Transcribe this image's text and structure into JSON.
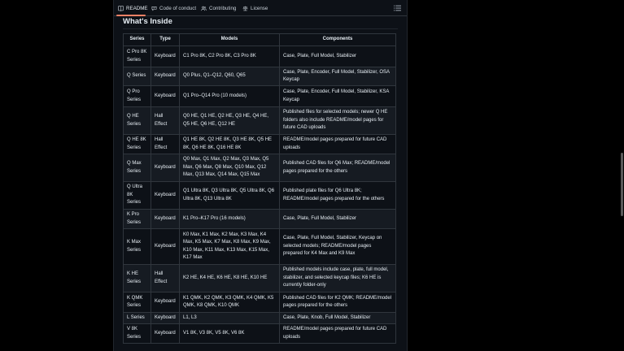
{
  "tabs": [
    {
      "label": "README",
      "icon": "book-icon",
      "active": true
    },
    {
      "label": "Code of conduct",
      "icon": "code-of-conduct-icon"
    },
    {
      "label": "Contributing",
      "icon": "people-icon"
    },
    {
      "label": "License",
      "icon": "law-icon"
    }
  ],
  "outline_icon": "list-icon",
  "section_title": "What's Inside",
  "table": {
    "headers": [
      "Series",
      "Type",
      "Models",
      "Components"
    ],
    "rows": [
      {
        "series": "C Pro 8K Series",
        "type": "Keyboard",
        "models": "C1 Pro 8K, C2 Pro 8K, C3 Pro 8K",
        "components": "Case, Plate, Full Model, Stabilizer"
      },
      {
        "series": "Q Series",
        "type": "Keyboard",
        "models": "Q0 Plus, Q1–Q12, Q60, Q65",
        "components": "Case, Plate, Encoder, Full Model, Stabilizer, OSA Keycap"
      },
      {
        "series": "Q Pro Series",
        "type": "Keyboard",
        "models": "Q1 Pro–Q14 Pro (10 models)",
        "components": "Case, Plate, Encoder, Full Model, Stabilizer, KSA Keycap"
      },
      {
        "series": "Q HE Series",
        "type": "Hall Effect",
        "models": "Q0 HE, Q1 HE, Q2 HE, Q3 HE, Q4 HE, Q5 HE, Q6 HE, Q12 HE",
        "components": "Published files for selected models; newer Q HE folders also include README/model pages for future CAD uploads"
      },
      {
        "series": "Q HE 8K Series",
        "type": "Hall Effect",
        "models": "Q1 HE 8K, Q2 HE 8K, Q3 HE 8K, Q5 HE 8K, Q6 HE 8K, Q16 HE 8K",
        "components": "README/model pages prepared for future CAD uploads"
      },
      {
        "series": "Q Max Series",
        "type": "Keyboard",
        "models": "Q0 Max, Q1 Max, Q2 Max, Q3 Max, Q5 Max, Q6 Max, Q8 Max, Q10 Max, Q12 Max, Q13 Max, Q14 Max, Q15 Max",
        "components": "Published CAD files for Q6 Max; README/model pages prepared for the others"
      },
      {
        "series": "Q Ultra 8K Series",
        "type": "Keyboard",
        "models": "Q1 Ultra 8K, Q3 Ultra 8K, Q5 Ultra 8K, Q6 Ultra 8K, Q13 Ultra 8K",
        "components": "Published plate files for Q6 Ultra 8K; README/model pages prepared for the others"
      },
      {
        "series": "K Pro Series",
        "type": "Keyboard",
        "models": "K1 Pro–K17 Pro (16 models)",
        "components": "Case, Plate, Full Model, Stabilizer"
      },
      {
        "series": "K Max Series",
        "type": "Keyboard",
        "models": "K0 Max, K1 Max, K2 Max, K3 Max, K4 Max, K5 Max, K7 Max, K8 Max, K9 Max, K10 Max, K11 Max, K13 Max, K15 Max, K17 Max",
        "components": "Case, Plate, Full Model, Stabilizer, Keycap on selected models; README/model pages prepared for K4 Max and K9 Max"
      },
      {
        "series": "K HE Series",
        "type": "Hall Effect",
        "models": "K2 HE, K4 HE, K6 HE, K8 HE, K10 HE",
        "components": "Published models include case, plate, full model, stabilizer, and selected keycap files; K6 HE is currently folder-only"
      },
      {
        "series": "K QMK Series",
        "type": "Keyboard",
        "models": "K1 QMK, K2 QMK, K3 QMK, K4 QMK, K5 QMK, K8 QMK, K10 QMK",
        "components": "Published CAD files for K2 QMK; README/model pages prepared for the others"
      },
      {
        "series": "L Series",
        "type": "Keyboard",
        "models": "L1, L3",
        "components": "Case, Plate, Knob, Full Model, Stabilizer"
      },
      {
        "series": "V 8K Series",
        "type": "Keyboard",
        "models": "V1 8K, V3 8K, V5 8K, V6 8K",
        "components": "README/model pages prepared for future CAD uploads"
      }
    ]
  },
  "colors": {
    "background": "#0d1117",
    "border": "#30363d",
    "text": "#e6edf3",
    "active_tab_accent": "#f78166"
  }
}
